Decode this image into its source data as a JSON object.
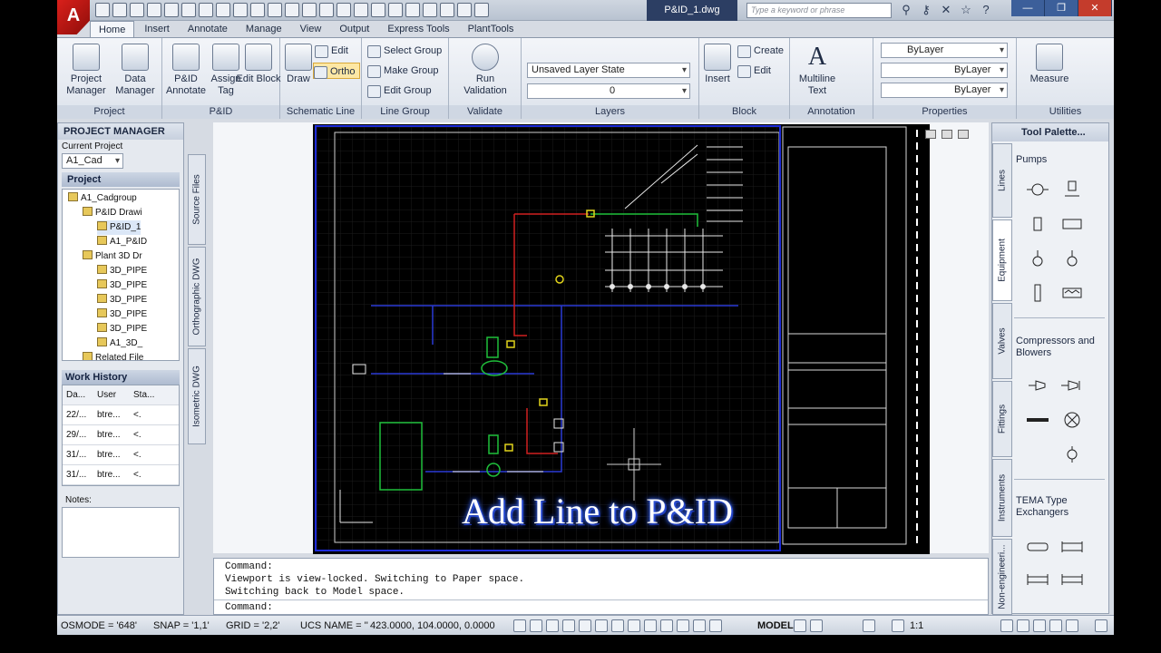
{
  "title_bar": {
    "logo": "A",
    "document_tab": "P&ID_1.dwg",
    "search_placeholder": "Type a keyword or phrase"
  },
  "ribbon_tabs": [
    "Home",
    "Insert",
    "Annotate",
    "Manage",
    "View",
    "Output",
    "Express Tools",
    "PlantTools"
  ],
  "ribbon": {
    "project": {
      "title": "Project",
      "btn1": "Project Manager",
      "btn2": "Data Manager"
    },
    "pid": {
      "title": "P&ID",
      "btn1": "P&ID Annotate",
      "btn2": "Assign Tag",
      "btn3": "Edit Block"
    },
    "schematic": {
      "title": "Schematic Line",
      "draw": "Draw",
      "edit": "Edit",
      "ortho": "Ortho"
    },
    "linegroup": {
      "title": "Line Group",
      "select": "Select Group",
      "make": "Make Group",
      "edit": "Edit Group"
    },
    "validate": {
      "title": "Validate",
      "run": "Run Validation"
    },
    "layers": {
      "title": "Layers",
      "state": "Unsaved Layer State",
      "layer": "0"
    },
    "block": {
      "title": "Block",
      "insert": "Insert",
      "create": "Create",
      "edit": "Edit"
    },
    "annotation": {
      "title": "Annotation",
      "mtext": "Multiline Text"
    },
    "properties": {
      "title": "Properties",
      "color": "ByLayer",
      "linetype": "ByLayer",
      "lineweight": "ByLayer"
    },
    "utilities": {
      "title": "Utilities",
      "measure": "Measure"
    }
  },
  "project_manager": {
    "header": "PROJECT MANAGER",
    "current_project_label": "Current Project",
    "current_project": "A1_Cad",
    "project_bar": "Project",
    "tree": [
      "A1_Cadgroup",
      "P&ID Drawi",
      "P&ID_1",
      "A1_P&ID",
      "Plant 3D Dr",
      "3D_PIPE",
      "3D_PIPE",
      "3D_PIPE",
      "3D_PIPE",
      "3D_PIPE",
      "A1_3D_",
      "Related File"
    ],
    "work_history": {
      "header": "Work History",
      "columns": [
        "Da...",
        "User",
        "Sta..."
      ],
      "rows": [
        [
          "22/...",
          "btre...",
          "<."
        ],
        [
          "29/...",
          "btre...",
          "<."
        ],
        [
          "31/...",
          "btre...",
          "<."
        ],
        [
          "31/...",
          "btre...",
          "<."
        ]
      ]
    },
    "notes_label": "Notes:"
  },
  "side_tabs": [
    "Source Files",
    "Orthographic DWG",
    "Isometric DWG"
  ],
  "overlay_caption": "Add Line to P&ID",
  "command_line": {
    "history": [
      "Command:",
      "Viewport is view-locked. Switching to Paper space.",
      "Switching back to Model space."
    ],
    "prompt": "Command:"
  },
  "tool_palette": {
    "header": "Tool Palette...",
    "tabs": [
      "Lines",
      "Equipment",
      "Valves",
      "Fittings",
      "Instruments",
      "Non-engineeri..."
    ],
    "sections": [
      "Pumps",
      "Compressors and Blowers",
      "TEMA Type Exchangers"
    ]
  },
  "status_bar": {
    "osmode": "OSMODE = '648'",
    "snap": "SNAP = '1,1'",
    "grid": "GRID = '2,2'",
    "ucs": "UCS NAME = ''",
    "coords": "423.0000, 104.0000, 0.0000",
    "model": "MODEL",
    "scale": "1:1"
  },
  "colors": {
    "model_border": "#1d2bd9",
    "pipe_blue": "#2b3bd6",
    "pipe_red": "#d02020",
    "equipment_green": "#1fbf3a",
    "instrument_yellow": "#e0d21a"
  }
}
